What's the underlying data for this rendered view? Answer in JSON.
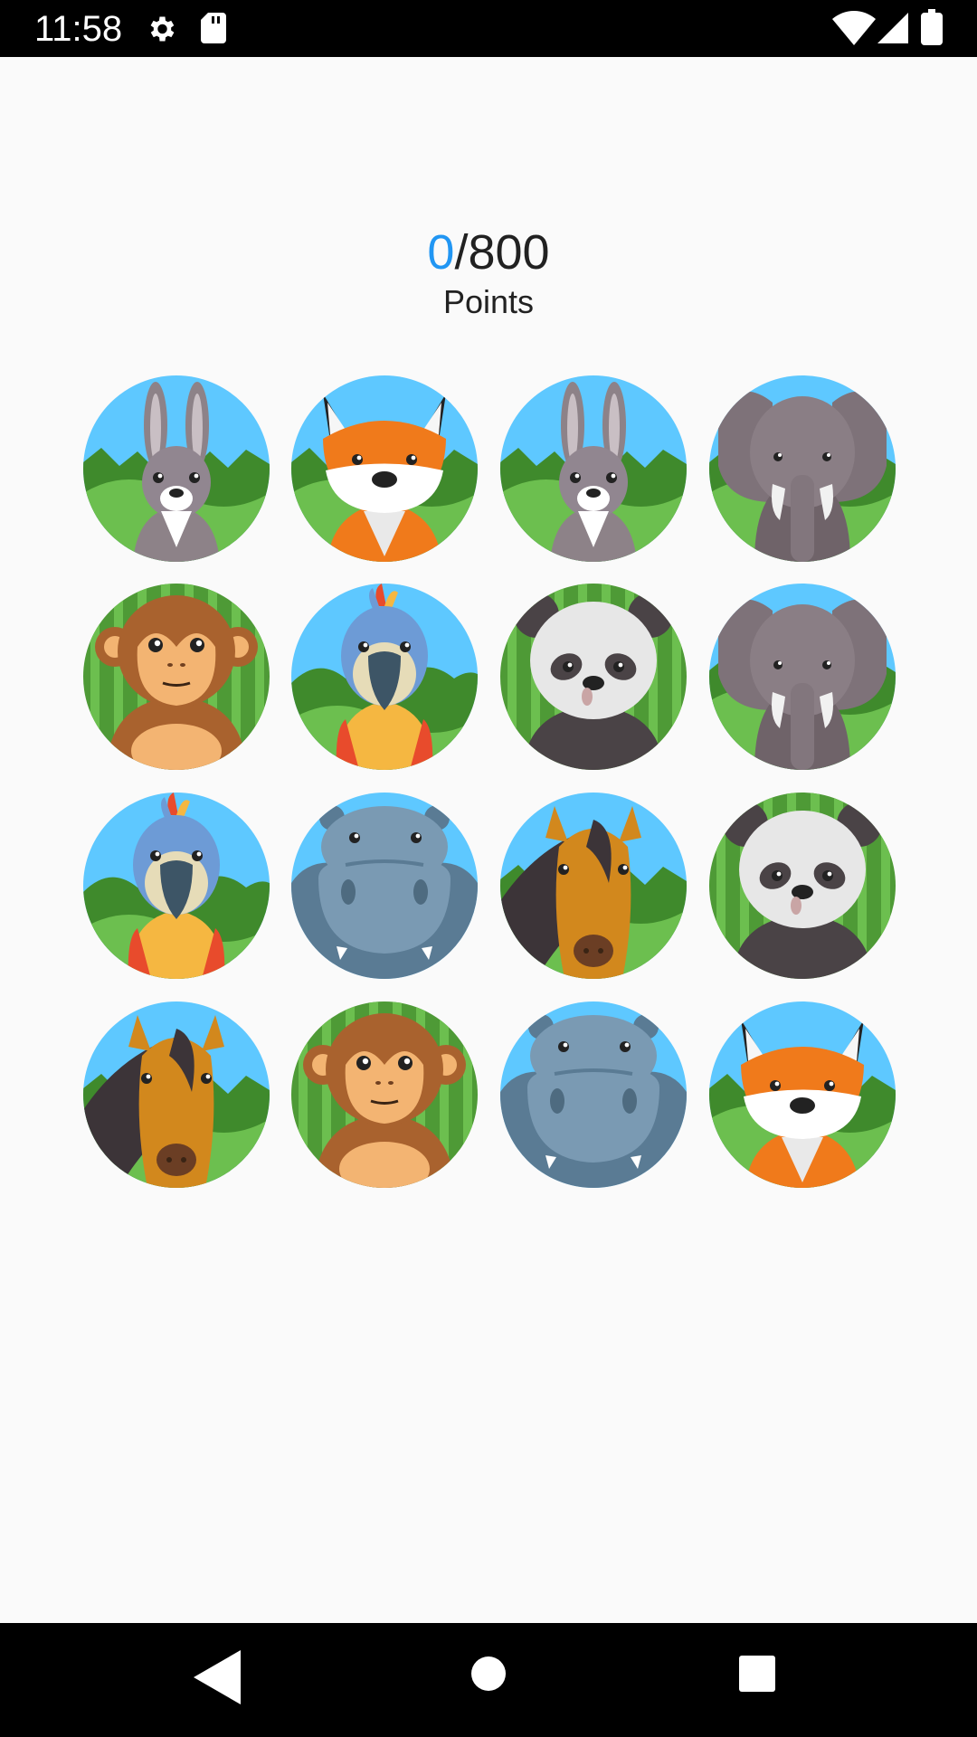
{
  "status": {
    "time": "11:58",
    "icons": [
      "gear-icon",
      "sd-card-icon",
      "wifi-icon",
      "signal-icon",
      "battery-icon"
    ]
  },
  "score": {
    "current": "0",
    "total": "/800",
    "label": "Points"
  },
  "colors": {
    "accent": "#2196f3",
    "sky": "#5ec8ff",
    "grass": "#4e9a36"
  },
  "grid": {
    "columns": 4,
    "rows": 4,
    "cards": [
      [
        "rabbit",
        "fox",
        "rabbit",
        "elephant"
      ],
      [
        "monkey",
        "parrot",
        "panda",
        "elephant"
      ],
      [
        "parrot",
        "hippo",
        "horse",
        "panda"
      ],
      [
        "horse",
        "monkey",
        "hippo",
        "fox"
      ]
    ]
  },
  "navigation": [
    "back-icon",
    "home-icon",
    "recents-icon"
  ]
}
